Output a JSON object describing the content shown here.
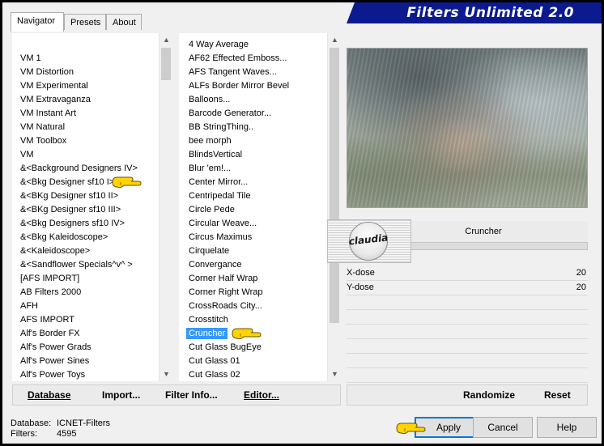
{
  "app": {
    "title": "Filters Unlimited 2.0"
  },
  "tabs": [
    {
      "label": "Navigator",
      "active": true
    },
    {
      "label": "Presets",
      "active": false
    },
    {
      "label": "About",
      "active": false
    }
  ],
  "category_list": {
    "items": [
      "VM 1",
      "VM Distortion",
      "VM Experimental",
      "VM Extravaganza",
      "VM Instant Art",
      "VM Natural",
      "VM Toolbox",
      "VM",
      "&<Background Designers IV>",
      "&<Bkg Designer sf10 I>",
      "&<BKg Designer sf10 II>",
      "&<BKg Designer sf10 III>",
      "&<Bkg Designers sf10 IV>",
      "&<Bkg Kaleidoscope>",
      "&<Kaleidoscope>",
      "&<Sandflower Specials^v^ >",
      "[AFS IMPORT]",
      "AB Filters 2000",
      "AFH",
      "AFS IMPORT",
      "Alf's Border FX",
      "Alf's Power Grads",
      "Alf's Power Sines",
      "Alf's Power Toys"
    ]
  },
  "filter_list": {
    "selected": "Cruncher",
    "items": [
      "4 Way Average",
      "AF62 Effected Emboss...",
      "AFS Tangent Waves...",
      "ALFs Border Mirror Bevel",
      "Balloons...",
      "Barcode Generator...",
      "BB StringThing..",
      "bee morph",
      "BlindsVertical",
      "Blur 'em!...",
      "Center Mirror...",
      "Centripedal Tile",
      "Circle Pede",
      "Circular Weave...",
      "Circus Maximus",
      "Cirquelate",
      "Convergance",
      "Corner Half Wrap",
      "Corner Right Wrap",
      "CrossRoads City...",
      "Crosstitch",
      "Cruncher",
      "Cut Glass  BugEye",
      "Cut Glass 01",
      "Cut Glass 02"
    ]
  },
  "filter_panel": {
    "name": "Cruncher",
    "params": [
      {
        "name": "X-dose",
        "value": "20"
      },
      {
        "name": "Y-dose",
        "value": "20"
      }
    ]
  },
  "watermark": {
    "text": "claudia"
  },
  "bottom_left_buttons": {
    "database": "Database",
    "import": "Import...",
    "filter_info": "Filter Info...",
    "editor": "Editor..."
  },
  "bottom_right_buttons": {
    "randomize": "Randomize",
    "reset": "Reset"
  },
  "status": {
    "database_label": "Database:",
    "database_value": "ICNET-Filters",
    "filters_label": "Filters:",
    "filters_value": "4595"
  },
  "dialog_buttons": {
    "apply": "Apply",
    "cancel": "Cancel",
    "help": "Help"
  },
  "colors": {
    "banner": "#0b1a8f",
    "selection": "#3399ff",
    "pointer": "#ffd400"
  }
}
